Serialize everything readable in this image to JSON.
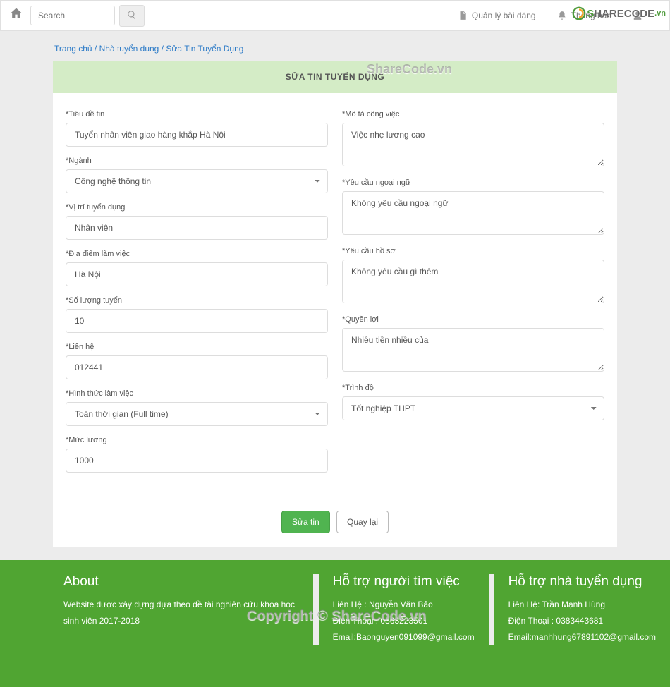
{
  "topbar": {
    "search_placeholder": "Search",
    "link_posts": "Quản lý bài đăng",
    "link_notify": "Thông báo"
  },
  "breadcrumb": {
    "home": "Trang chủ",
    "sep1": " / ",
    "employer": "Nhà tuyển dụng",
    "sep2": " / ",
    "edit": "Sửa Tin Tuyển Dụng"
  },
  "page_title": "SỬA TIN TUYỂN DỤNG",
  "form": {
    "title_label": "*Tiêu đề tin",
    "title_value": "Tuyển nhân viên giao hàng khắp Hà Nội",
    "industry_label": "*Ngành",
    "industry_value": "Công nghệ thông tin",
    "position_label": "*Vị trí tuyển dụng",
    "position_value": "Nhân viên",
    "location_label": "*Địa điểm làm việc",
    "location_value": "Hà Nội",
    "quantity_label": "*Số lượng tuyển",
    "quantity_value": "10",
    "contact_label": "*Liên hệ",
    "contact_value": "012441",
    "worktype_label": "*Hình thức làm việc",
    "worktype_value": "Toàn thời gian (Full time)",
    "salary_label": "*Mức lương",
    "salary_value": "1000",
    "desc_label": "*Mô tả công việc",
    "desc_value": "Việc nhẹ lương cao",
    "lang_label": "*Yêu cầu ngoại ngữ",
    "lang_value": "Không yêu cầu ngoại ngữ",
    "cv_label": "*Yêu cầu hồ sơ",
    "cv_value": "Không yêu cầu gì thêm",
    "benefit_label": "*Quyền lợi",
    "benefit_value": "Nhiều tiền nhiều của",
    "edu_label": "*Trình độ",
    "edu_value": "Tốt nghiệp THPT"
  },
  "buttons": {
    "save": "Sửa tin",
    "back": "Quay lại"
  },
  "footer": {
    "about_title": "About",
    "about_text": "Website được xây dựng dựa theo đề tài nghiên cứu khoa học sinh viên 2017-2018",
    "seeker_title": "Hỗ trợ người tìm việc",
    "seeker_contact": "Liên Hệ : Nguyễn Văn Bảo",
    "seeker_phone": "Điện Thoại : 0363223501",
    "seeker_email": "Email:Baonguyen091099@gmail.com",
    "employer_title": "Hỗ trợ nhà tuyển dụng",
    "employer_contact": "Liên Hệ: Trần Mạnh Hùng",
    "employer_phone": "Điện Thoại : 0383443681",
    "employer_email": "Email:manhhung67891102@gmail.com"
  },
  "watermark": {
    "top": "ShareCode.vn",
    "bottom": "Copyright © ShareCode.vn",
    "logo_s": "S",
    "logo_rest": "HARECODE",
    "logo_vn": ".vn"
  }
}
